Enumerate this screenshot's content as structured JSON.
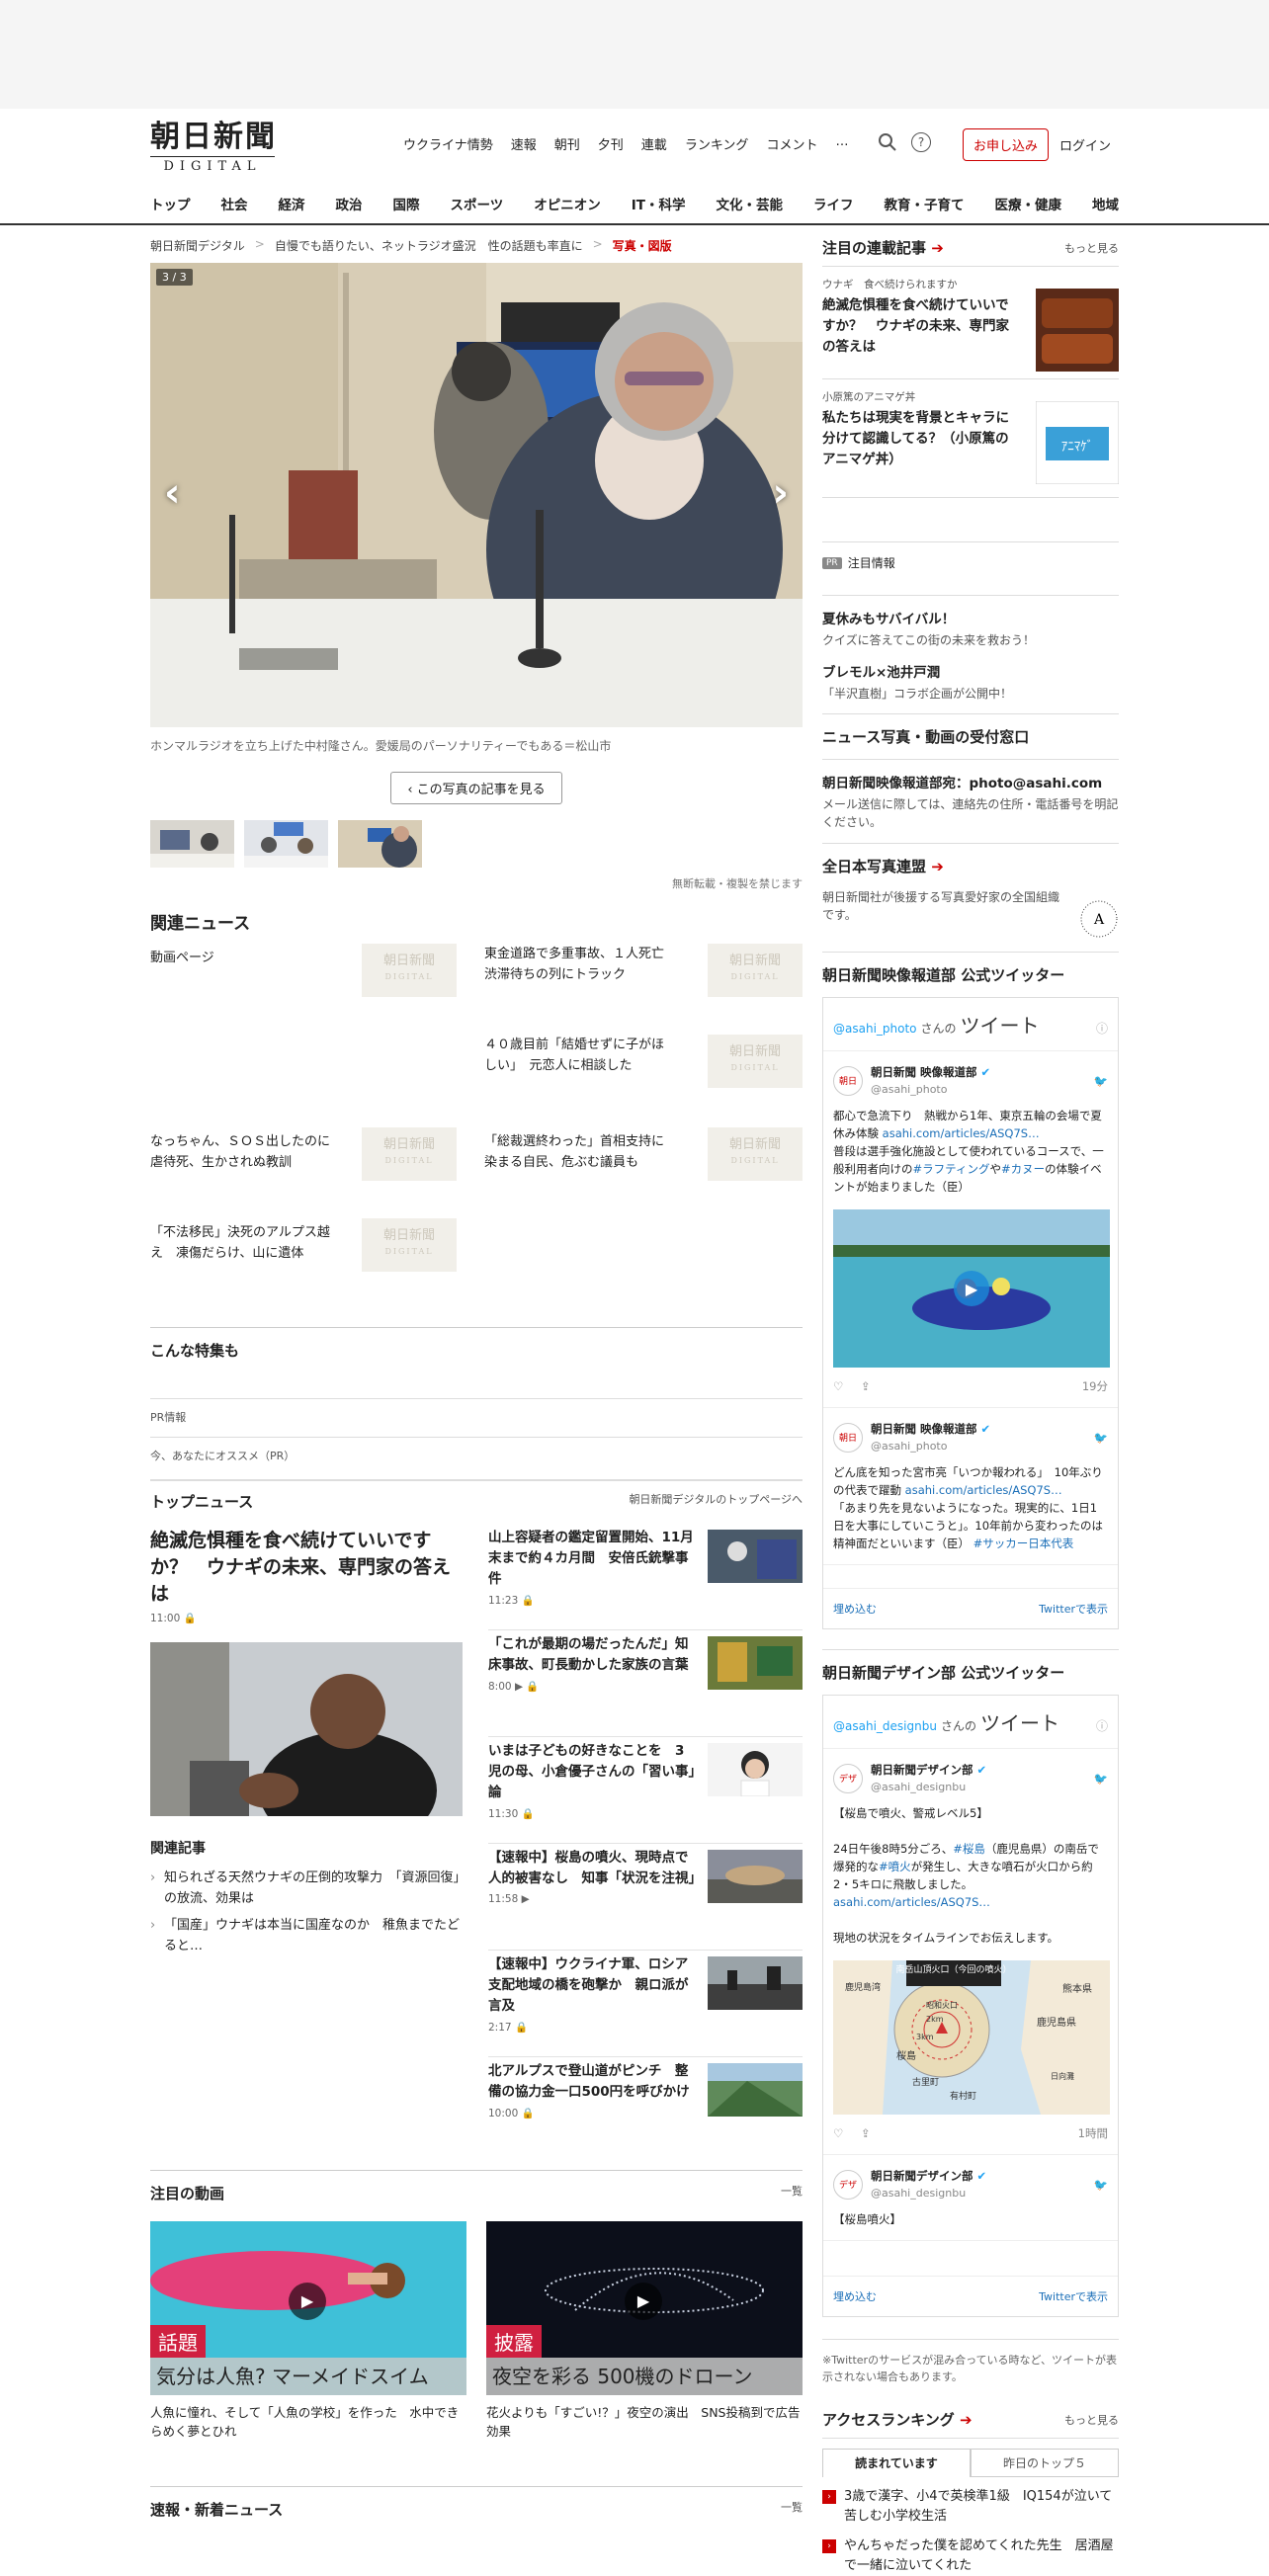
{
  "header": {
    "logo_main": "朝日新聞",
    "logo_sub": "DIGITAL",
    "top_nav": [
      "ウクライナ情勢",
      "速報",
      "朝刊",
      "夕刊",
      "連載",
      "ランキング",
      "コメント",
      "…"
    ],
    "apply": "お申し込み",
    "login": "ログイン",
    "categories": [
      "トップ",
      "社会",
      "経済",
      "政治",
      "国際",
      "スポーツ",
      "オピニオン",
      "IT・科学",
      "文化・芸能",
      "ライフ",
      "教育・子育て",
      "医療・健康",
      "地域"
    ]
  },
  "breadcrumb": {
    "home": "朝日新聞デジタル",
    "article": "自慢でも語りたい、ネットラジオ盛況　性の話題も率直に",
    "current": "写真・図版"
  },
  "photo": {
    "counter": "3 / 3",
    "caption": "ホンマルラジオを立ち上げた中村隆さん。愛媛局のパーソナリティーでもある＝松山市",
    "view_button": "この写真の記事を見る",
    "copyright": "無断転載・複製を禁じます"
  },
  "related": {
    "title": "関連ニュース",
    "items": [
      "動画ページ",
      "東金道路で多重事故、１人死亡　渋滞待ちの列にトラック",
      "４０歳目前「結婚せずに子がほしい」　元恋人に相談した",
      "なっちゃん、ＳＯＳ出したのに　虐待死、生かされぬ教訓",
      "「総裁選終わった」首相支持に染まる自民、危ぶむ議員も",
      "「不法移民」決死のアルプス越え　凍傷だらけ、山に遺体"
    ],
    "placeholder_main": "朝日新聞",
    "placeholder_sub": "DIGITAL"
  },
  "tokushu": {
    "title": "こんな特集も",
    "pr": "PR情報",
    "recommend": "今、あなたにオススメ（PR）"
  },
  "top_news": {
    "title": "トップニュース",
    "link": "朝日新聞デジタルのトップページへ",
    "lead_title": "絶滅危惧種を食べ続けていいですか？　ウナギの未来、専門家の答えは",
    "lead_time": "11:00",
    "related_label": "関連記事",
    "related_items": [
      "知られざる天然ウナギの圧倒的攻撃力　「資源回復」の放流、効果は",
      "「国産」ウナギは本当に国産なのか　稚魚までたどると…"
    ],
    "items": [
      {
        "title": "山上容疑者の鑑定留置開始、11月末まで約４カ月間　安倍氏銃撃事件",
        "time": "11:23"
      },
      {
        "title": "「これが最期の場だったんだ」知床事故、町長動かした家族の言葉",
        "time": "8:00"
      },
      {
        "title": "いまは子どもの好きなことを　3児の母、小倉優子さんの「習い事」論",
        "time": "11:30"
      },
      {
        "title": "【速報中】桜島の噴火、現時点で人的被害なし　知事「状況を注視」",
        "time": "11:58"
      },
      {
        "title": "【速報中】ウクライナ軍、ロシア支配地域の橋を砲撃か　親ロ派が言及",
        "time": "2:17"
      },
      {
        "title": "北アルプスで登山道がピンチ　整備の協力金一口500円を呼びかけ",
        "time": "10:00"
      }
    ]
  },
  "videos": {
    "title": "注目の動画",
    "more": "一覧",
    "items": [
      {
        "tag": "話題",
        "caption": "気分は人魚? マーメイドスイム",
        "text": "人魚に憧れ、そして「人魚の学校」を作った　水中できらめく夢とひれ"
      },
      {
        "tag": "披露",
        "caption": "夜空を彩る 500機のドローン",
        "text": "花火よりも「すごい!？」夜空の演出　SNS投稿到で広告効果"
      }
    ]
  },
  "sokuhou": {
    "title": "速報・新着ニュース",
    "more": "一覧"
  },
  "right": {
    "renzai_title": "注目の連載記事",
    "more": "もっと見る",
    "renzai": [
      {
        "cat": "ウナギ　食べ続けられますか",
        "title": "絶滅危惧種を食べ続けていいですか？　ウナギの未来、専門家の答えは"
      },
      {
        "cat": "小原篤のアニマゲ丼",
        "title": "私たちは現実を背景とキャラに分けて認識してる？（小原篤のアニマゲ丼）"
      }
    ],
    "pr_label": "PR",
    "pr_title": "注目情報",
    "pr_items": [
      {
        "h": "夏休みもサバイバル！",
        "s": "クイズに答えてこの街の未来を救おう！"
      },
      {
        "h": "ブレモル×池井戸潤",
        "s": "「半沢直樹」コラボ企画が公開中！"
      }
    ],
    "photo_submit_title": "ニュース写真・動画の受付窓口",
    "photo_submit_h": "朝日新聞映像報道部宛：photo@asahi.com",
    "photo_submit_s": "メール送信に際しては、連絡先の住所・電話番号を明記ください。",
    "contest_title": "全日本写真連盟",
    "contest_text": "朝日新聞社が後援する写真愛好家の全国組織です。",
    "twitter1_title": "朝日新聞映像報道部 公式ツイッター",
    "twitter1": {
      "handle_link": "@asahi_photo",
      "san": "さんの",
      "tweets": "ツイート",
      "name": "朝日新聞 映像報道部",
      "handle": "@asahi_photo",
      "t1": "都心で急流下り　熱戦から1年、東京五輪の会場で夏休み体験",
      "t1_link": "asahi.com/articles/ASQ7S…",
      "t1b": "普段は選手強化施設として使われているコースで、一般利用者向けの",
      "t1_tag1": "#ラフティング",
      "t1_mid": "や",
      "t1_tag2": "#カヌー",
      "t1_end": "の体験イベントが始まりました（臣）",
      "time1": "19分",
      "t2": "どん底を知った宮市亮「いつか報われる」　10年ぶりの代表で躍動",
      "t2_link": "asahi.com/articles/ASQ7S…",
      "t2b": "「あまり先を見ないようになった。現実的に、1日1日を大事にしていこうと」。10年前から変わったのは精神面だといいます（臣）",
      "t2_tag": "#サッカー日本代表",
      "embed": "埋め込む",
      "view": "Twitterで表示"
    },
    "twitter2_title": "朝日新聞デザイン部 公式ツイッター",
    "twitter2": {
      "handle_link": "@asahi_designbu",
      "san": "さんの",
      "tweets": "ツイート",
      "name": "朝日新聞デザイン部",
      "handle": "@asahi_designbu",
      "t1": "【桜島で噴火、警戒レベル5】",
      "t1b_pre": "24日午後8時5分ごろ、",
      "t1_tag1": "#桜島",
      "t1b_mid": "（鹿児島県）の南岳で爆発的な",
      "t1_tag2": "#噴火",
      "t1b_end": "が発生し、大きな噴石が火口から約2・5キロに飛散しました。",
      "t1_link": "asahi.com/articles/ASQ7S…",
      "t1c": "現地の状況をタイムラインでお伝えします。",
      "map_title": "南岳山頂火口（今回の噴火）",
      "map_labels": [
        "鹿児島湾",
        "熊本県",
        "鹿児島県",
        "昭和火口",
        "2km",
        "3km",
        "桜島",
        "古里町",
        "有村町",
        "日向灘"
      ],
      "time1": "1時間",
      "t2": "【桜島噴火】",
      "embed": "埋め込む",
      "view": "Twitterで表示"
    },
    "twitter_note": "※Twitterのサービスが混み合っている時など、ツイートが表示されない場合もあります。",
    "ranking_title": "アクセスランキング",
    "ranking_tabs": [
      "読まれています",
      "昨日のトップ５"
    ],
    "ranking": [
      "3歳で漢字、小4で英検準1級　IQ154が泣いて苦しむ小学校生活",
      "やんちゃだった僕を認めてくれた先生　居酒屋で一緒に泣いてくれた"
    ]
  }
}
